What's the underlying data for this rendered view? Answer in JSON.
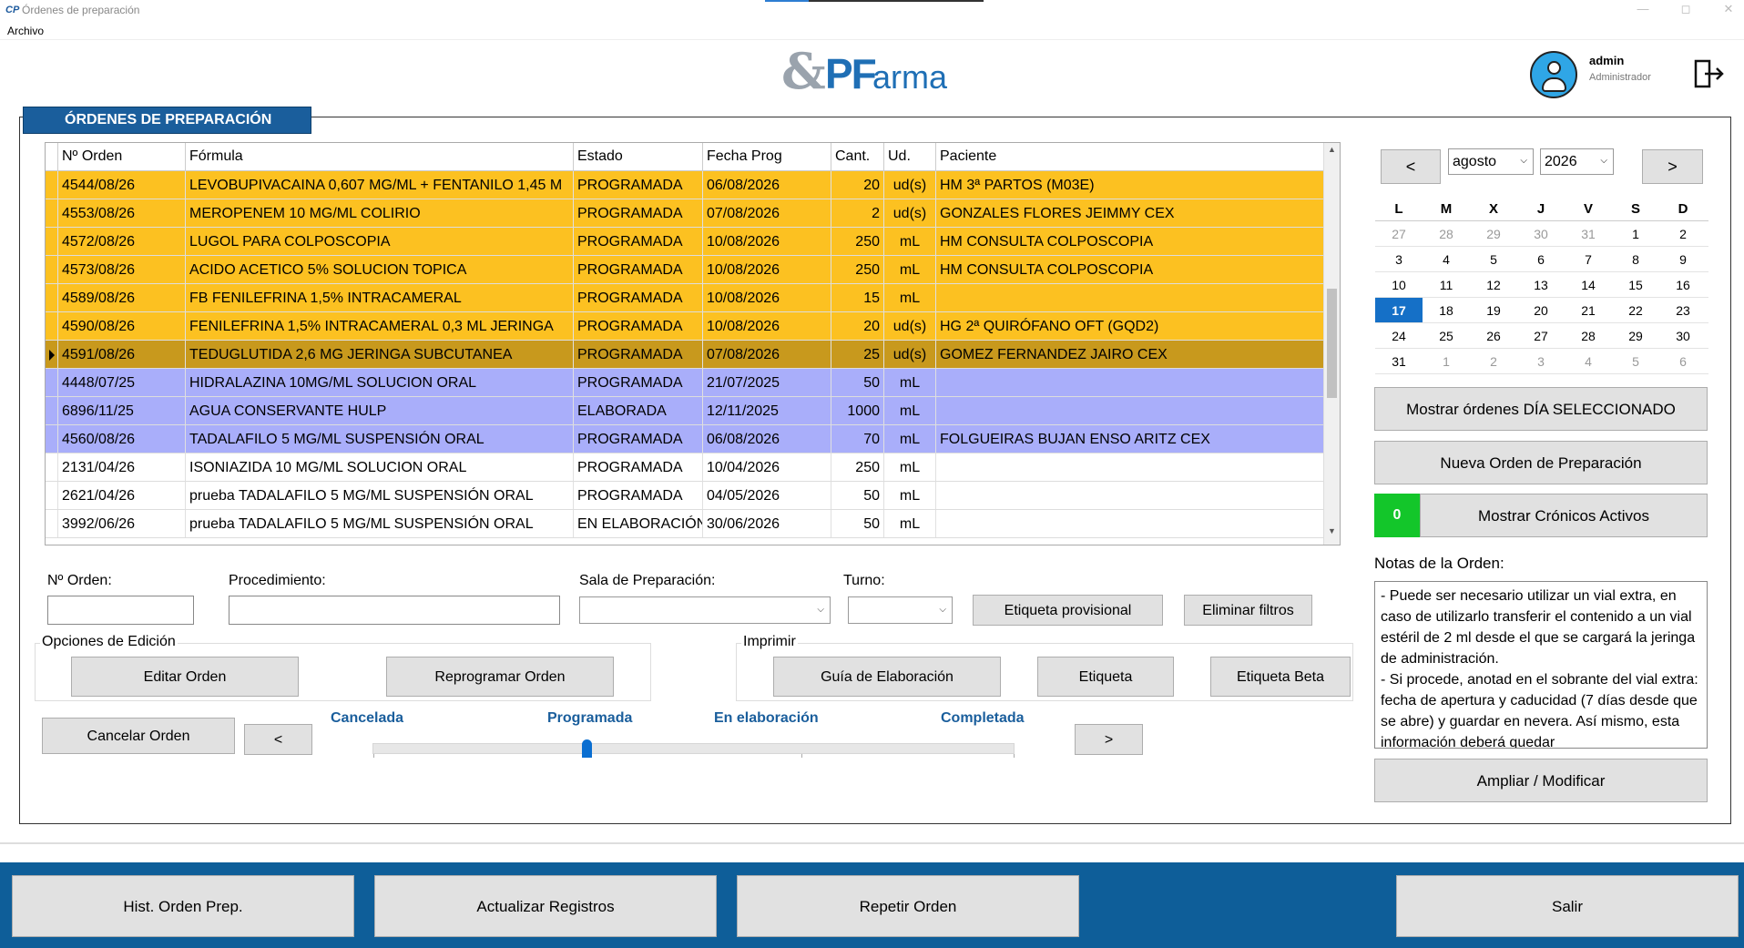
{
  "window": {
    "title": "Órdenes de preparación",
    "app_icon": "CP"
  },
  "menu": {
    "archivo": "Archivo"
  },
  "header": {
    "user_name": "admin",
    "user_role": "Administrador"
  },
  "panel": {
    "title": "ÓRDENES DE PREPARACIÓN"
  },
  "grid": {
    "columns": [
      "Nº Orden",
      "Fórmula",
      "Estado",
      "Fecha Prog",
      "Cant.",
      "Ud.",
      "Paciente"
    ],
    "rows": [
      {
        "orden": "4544/08/26",
        "formula": "LEVOBUPIVACAINA 0,607 MG/ML + FENTANILO 1,45 M",
        "estado": "PROGRAMADA",
        "fecha": "06/08/2026",
        "cant": "20",
        "ud": "ud(s)",
        "paciente": "HM 3ª PARTOS (M03E)",
        "color": "#fcc121"
      },
      {
        "orden": "4553/08/26",
        "formula": "MEROPENEM 10 MG/ML COLIRIO",
        "estado": "PROGRAMADA",
        "fecha": "07/08/2026",
        "cant": "2",
        "ud": "ud(s)",
        "paciente": "GONZALES FLORES JEIMMY CEX",
        "color": "#fcc121"
      },
      {
        "orden": "4572/08/26",
        "formula": "LUGOL PARA COLPOSCOPIA",
        "estado": "PROGRAMADA",
        "fecha": "10/08/2026",
        "cant": "250",
        "ud": "mL",
        "paciente": "HM CONSULTA COLPOSCOPIA",
        "color": "#fcc121"
      },
      {
        "orden": "4573/08/26",
        "formula": "ACIDO ACETICO 5% SOLUCION TOPICA",
        "estado": "PROGRAMADA",
        "fecha": "10/08/2026",
        "cant": "250",
        "ud": "mL",
        "paciente": "HM CONSULTA COLPOSCOPIA",
        "color": "#fcc121"
      },
      {
        "orden": "4589/08/26",
        "formula": "FB FENILEFRINA 1,5% INTRACAMERAL",
        "estado": "PROGRAMADA",
        "fecha": "10/08/2026",
        "cant": "15",
        "ud": "mL",
        "paciente": "",
        "color": "#fcc121"
      },
      {
        "orden": "4590/08/26",
        "formula": "FENILEFRINA 1,5% INTRACAMERAL 0,3 ML JERINGA",
        "estado": "PROGRAMADA",
        "fecha": "10/08/2026",
        "cant": "20",
        "ud": "ud(s)",
        "paciente": "HG 2ª QUIRÓFANO OFT (GQD2)",
        "color": "#fcc121"
      },
      {
        "orden": "4591/08/26",
        "formula": "TEDUGLUTIDA 2,6 MG JERINGA SUBCUTANEA",
        "estado": "PROGRAMADA",
        "fecha": "07/08/2026",
        "cant": "25",
        "ud": "ud(s)",
        "paciente": "GOMEZ FERNANDEZ JAIRO CEX",
        "color": "#c8991d",
        "selected": true
      },
      {
        "orden": "4448/07/25",
        "formula": "HIDRALAZINA 10MG/ML SOLUCION ORAL",
        "estado": "PROGRAMADA",
        "fecha": "21/07/2025",
        "cant": "50",
        "ud": "mL",
        "paciente": "",
        "color": "#a9aefa"
      },
      {
        "orden": "6896/11/25",
        "formula": "AGUA CONSERVANTE HULP",
        "estado": "ELABORADA",
        "fecha": "12/11/2025",
        "cant": "1000",
        "ud": "mL",
        "paciente": "",
        "color": "#a9aefa"
      },
      {
        "orden": "4560/08/26",
        "formula": "TADALAFILO 5 MG/ML SUSPENSIÓN ORAL",
        "estado": "PROGRAMADA",
        "fecha": "06/08/2026",
        "cant": "70",
        "ud": "mL",
        "paciente": "FOLGUEIRAS BUJAN ENSO ARITZ CEX",
        "color": "#a9aefa"
      },
      {
        "orden": "2131/04/26",
        "formula": "ISONIAZIDA 10 MG/ML SOLUCION ORAL",
        "estado": "PROGRAMADA",
        "fecha": "10/04/2026",
        "cant": "250",
        "ud": "mL",
        "paciente": "",
        "color": "#ffffff"
      },
      {
        "orden": "2621/04/26",
        "formula": "prueba TADALAFILO 5 MG/ML SUSPENSIÓN ORAL",
        "estado": "PROGRAMADA",
        "fecha": "04/05/2026",
        "cant": "50",
        "ud": "mL",
        "paciente": "",
        "color": "#ffffff"
      },
      {
        "orden": "3992/06/26",
        "formula": "prueba TADALAFILO 5 MG/ML SUSPENSIÓN ORAL",
        "estado": "EN ELABORACIÓN",
        "fecha": "30/06/2026",
        "cant": "50",
        "ud": "mL",
        "paciente": "",
        "color": "#ffffff"
      }
    ]
  },
  "filters": {
    "orden_label": "Nº Orden:",
    "procedimiento_label": "Procedimiento:",
    "sala_label": "Sala de Preparación:",
    "turno_label": "Turno:",
    "etiqueta_provisional": "Etiqueta provisional",
    "eliminar_filtros": "Eliminar filtros"
  },
  "edicion": {
    "label": "Opciones de Edición",
    "editar": "Editar Orden",
    "reprogramar": "Reprogramar Orden"
  },
  "imprimir": {
    "label": "Imprimir",
    "guia": "Guía de Elaboración",
    "etiqueta": "Etiqueta",
    "etiqueta_beta": "Etiqueta Beta"
  },
  "workflow": {
    "cancelar": "Cancelar Orden",
    "prev": "<",
    "next": ">",
    "steps": [
      "Cancelada",
      "Programada",
      "En elaboración",
      "Completada"
    ],
    "current_step": 1
  },
  "calendar": {
    "prev": "<",
    "next": ">",
    "month": "agosto",
    "year": "2026",
    "weekdays": [
      "L",
      "M",
      "X",
      "J",
      "V",
      "S",
      "D"
    ],
    "weeks": [
      [
        "27",
        "28",
        "29",
        "30",
        "31",
        "1",
        "2"
      ],
      [
        "3",
        "4",
        "5",
        "6",
        "7",
        "8",
        "9"
      ],
      [
        "10",
        "11",
        "12",
        "13",
        "14",
        "15",
        "16"
      ],
      [
        "17",
        "18",
        "19",
        "20",
        "21",
        "22",
        "23"
      ],
      [
        "24",
        "25",
        "26",
        "27",
        "28",
        "29",
        "30"
      ],
      [
        "31",
        "1",
        "2",
        "3",
        "4",
        "5",
        "6"
      ]
    ],
    "selected": "17"
  },
  "side": {
    "mostrar_dia": "Mostrar órdenes DÍA SELECCIONADO",
    "nueva_orden": "Nueva Orden de Preparación",
    "cronicos_count": "0",
    "mostrar_cronicos": "Mostrar Crónicos Activos",
    "notas_label": "Notas de la Orden:",
    "notas_text": "- Puede ser necesario utilizar un vial extra, en caso de utilizarlo transferir el contenido a un vial estéril de 2 ml desde el que se cargará la jeringa de administración.\n- Si procede, anotad en el sobrante del vial extra: fecha de apertura y caducidad (7 días desde que se abre) y guardar en nevera. Así mismo, esta información deberá quedar",
    "ampliar": "Ampliar / Modificar"
  },
  "bottom": {
    "hist": "Hist. Orden Prep.",
    "actualizar": "Actualizar Registros",
    "repetir": "Repetir Orden",
    "salir": "Salir"
  },
  "colors": {
    "brand": "#1a5e9c",
    "bottom_bar": "#0e5e99",
    "badge": "#13c62a",
    "selected_day": "#1570c7"
  }
}
